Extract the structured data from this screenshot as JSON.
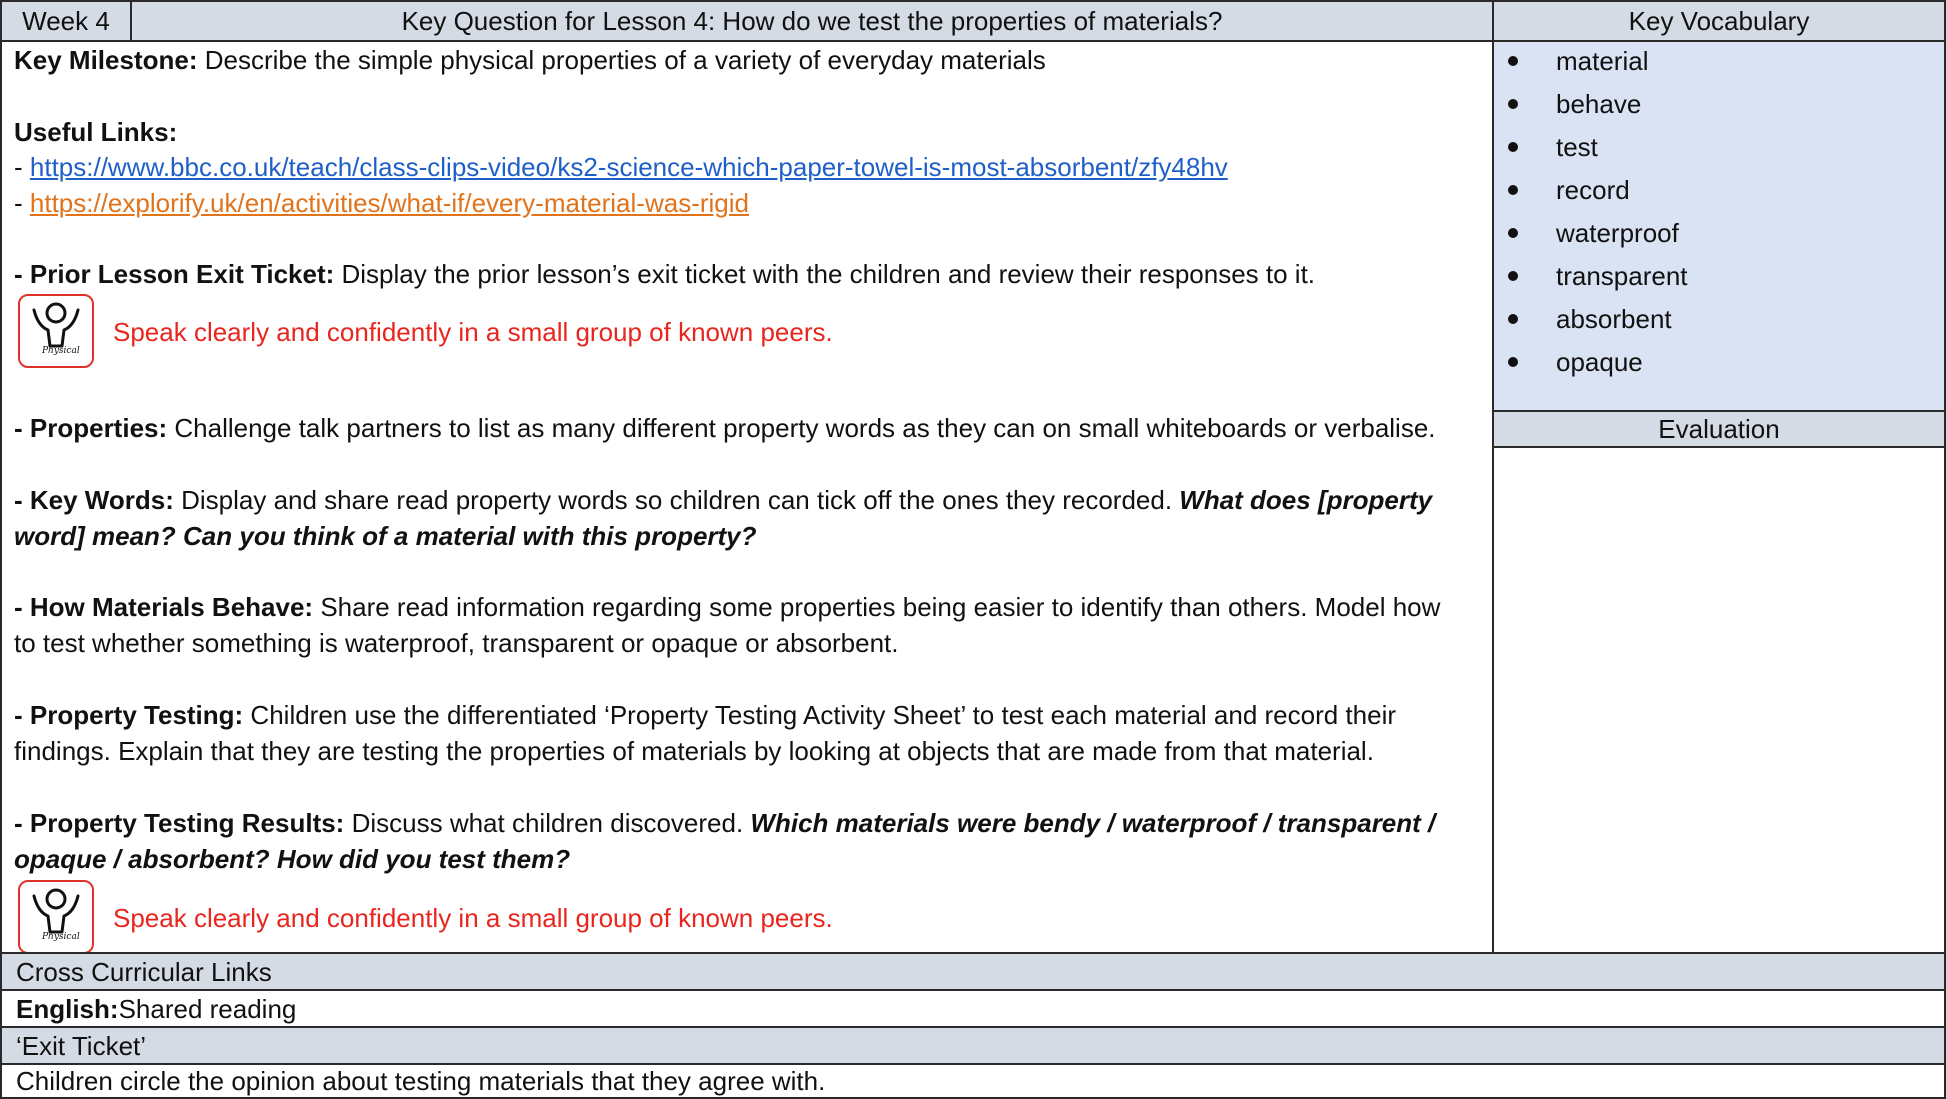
{
  "header": {
    "week": "Week 4",
    "key_question": "Key Question for Lesson 4: How do we test the properties of materials?",
    "key_vocabulary": "Key Vocabulary",
    "evaluation": "Evaluation"
  },
  "milestone": {
    "label": "Key Milestone:",
    "text": " Describe the simple physical properties of a variety of everyday materials"
  },
  "links": {
    "label": "Useful Links:",
    "dash": "- ",
    "link1": "https://www.bbc.co.uk/teach/class-clips-video/ks2-science-which-paper-towel-is-most-absorbent/zfy48hv",
    "link2": "https://explorify.uk/en/activities/what-if/every-material-was-rigid"
  },
  "sections": {
    "prior": {
      "label": "- Prior Lesson Exit Ticket:",
      "text": " Display the prior lesson’s exit ticket with the children and review their responses to it."
    },
    "speak1": "Speak clearly and confidently in a small group of known peers.",
    "properties": {
      "label": "- Properties:",
      "text": " Challenge talk partners to list as many different property words as they can on small whiteboards or verbalise."
    },
    "keywords": {
      "label": "- Key Words:",
      "text": " Display and share read property words so children can tick off the ones they recorded. ",
      "question_a": "What does [property",
      "question_b": "word] mean? Can you think of a material with this property?"
    },
    "behave": {
      "label": "- How Materials Behave:",
      "text_a": " Share read information regarding some properties being easier to identify than others. Model how",
      "text_b": "to test whether something is waterproof, transparent or opaque or absorbent."
    },
    "testing": {
      "label": "- Property Testing:",
      "text_a": " Children use the differentiated ‘Property Testing Activity Sheet’ to test each material and record their",
      "text_b": "findings. Explain that they are testing the properties of materials by looking at objects that are made from that material."
    },
    "results": {
      "label": "- Property Testing Results:",
      "text": " Discuss what children discovered. ",
      "question_a": "Which materials were bendy / waterproof / transparent /",
      "question_b": "opaque / absorbent? How did you test them?"
    },
    "speak2": "Speak clearly and confidently in a small group of known peers."
  },
  "icon": {
    "label": "Physical"
  },
  "vocabulary": [
    "material",
    "behave",
    "test",
    "record",
    "waterproof",
    "transparent",
    "absorbent",
    "opaque"
  ],
  "cross_curricular": {
    "heading": "Cross Curricular Links",
    "english_label": "English:",
    "english_text": " Shared reading"
  },
  "exit_ticket": {
    "heading": "‘Exit Ticket’",
    "text": "Children circle the opinion about testing materials that they agree with."
  },
  "colors": {
    "header_fill": "#d5dbe4",
    "vocab_fill": "#dae3f3",
    "link_blue": "#1f5fc8",
    "link_orange": "#e1731b",
    "speak_red": "#e8261e"
  }
}
